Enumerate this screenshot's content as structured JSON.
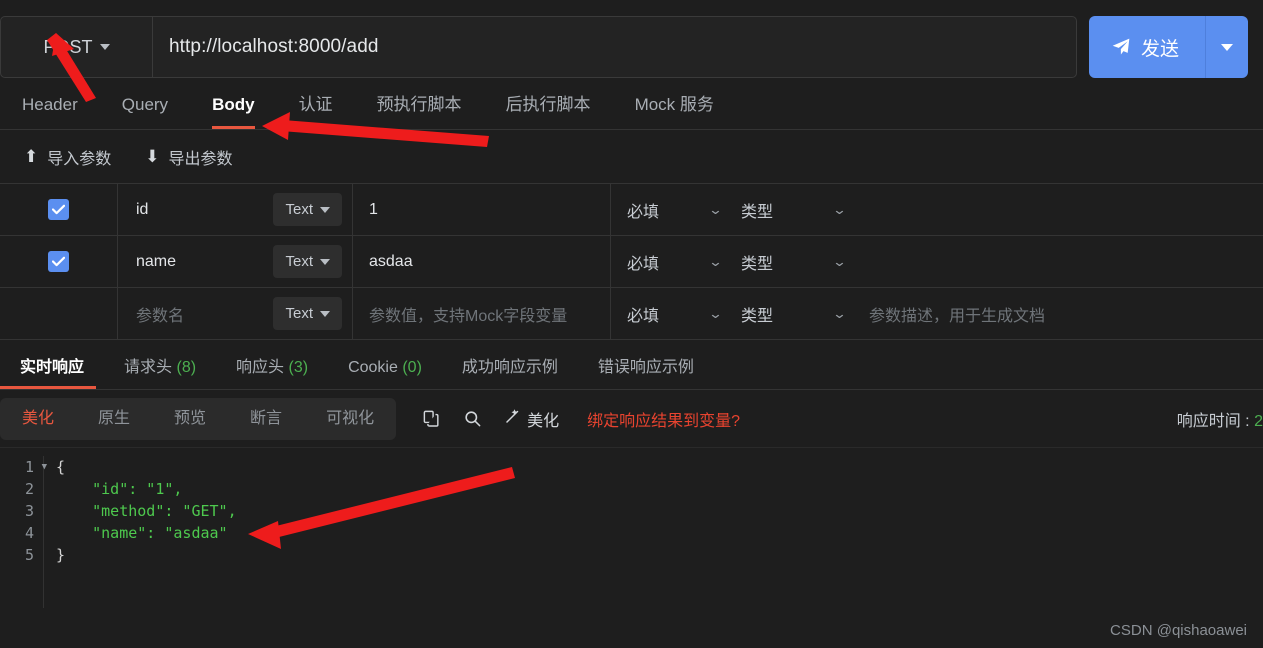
{
  "request": {
    "method": "POST",
    "url": "http://localhost:8000/add",
    "send_label": "发送"
  },
  "main_tabs": [
    {
      "label": "Header",
      "active": false
    },
    {
      "label": "Query",
      "active": false
    },
    {
      "label": "Body",
      "active": true
    },
    {
      "label": "认证",
      "active": false
    },
    {
      "label": "预执行脚本",
      "active": false
    },
    {
      "label": "后执行脚本",
      "active": false
    },
    {
      "label": "Mock 服务",
      "active": false
    }
  ],
  "io_bar": {
    "import_label": "导入参数",
    "export_label": "导出参数"
  },
  "param_table": {
    "type_label": "Text",
    "required_label": "必填",
    "type_col_label": "类型",
    "placeholder_name": "参数名",
    "placeholder_value": "参数值，支持Mock字段变量",
    "placeholder_desc": "参数描述，用于生成文档",
    "rows": [
      {
        "checked": true,
        "name": "id",
        "type": "Text",
        "value": "1",
        "required": "必填",
        "coltype": "类型",
        "desc": ""
      },
      {
        "checked": true,
        "name": "name",
        "type": "Text",
        "value": "asdaa",
        "required": "必填",
        "coltype": "类型",
        "desc": ""
      },
      {
        "checked": false,
        "name": "参数名",
        "type": "Text",
        "value": "参数值，支持Mock字段变量",
        "required": "必填",
        "coltype": "类型",
        "desc": "参数描述，用于生成文档"
      }
    ]
  },
  "response_tabs": [
    {
      "label": "实时响应",
      "count": "",
      "active": true
    },
    {
      "label": "请求头",
      "count": "(8)",
      "active": false
    },
    {
      "label": "响应头",
      "count": "(3)",
      "active": false
    },
    {
      "label": "Cookie",
      "count": "(0)",
      "active": false
    },
    {
      "label": "成功响应示例",
      "count": "",
      "active": false
    },
    {
      "label": "错误响应示例",
      "count": "",
      "active": false
    }
  ],
  "response_toolbar": {
    "segments": [
      {
        "label": "美化",
        "active": true
      },
      {
        "label": "原生",
        "active": false
      },
      {
        "label": "预览",
        "active": false
      },
      {
        "label": "断言",
        "active": false
      },
      {
        "label": "可视化",
        "active": false
      }
    ],
    "beautify_label": "美化",
    "bind_link": "绑定响应结果到变量?",
    "resp_time_label": "响应时间 :",
    "resp_time_value": "2"
  },
  "code": {
    "lines": [
      "1",
      "2",
      "3",
      "4",
      "5"
    ],
    "l1": "{",
    "l2": "    \"id\": \"1\",",
    "l3": "    \"method\": \"GET\",",
    "l4": "    \"name\": \"asdaa\"",
    "l5": "}"
  },
  "watermark": "CSDN @qishaoawei",
  "colors": {
    "accent_blue": "#5b8ff0",
    "accent_red": "#e8573f",
    "count_green": "#4caf50",
    "code_green": "#4ec94e",
    "bg": "#1e1e1e"
  }
}
